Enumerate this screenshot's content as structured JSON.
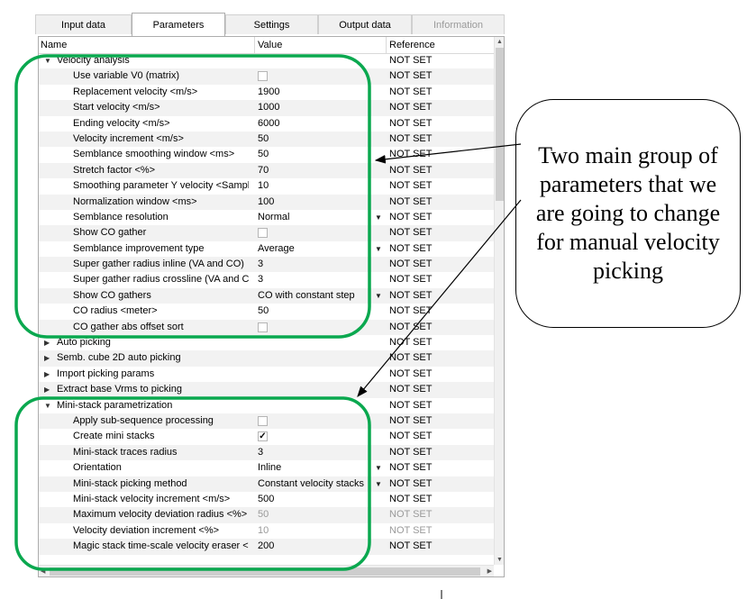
{
  "tabs": [
    {
      "label": "Input data",
      "state": "normal"
    },
    {
      "label": "Parameters",
      "state": "active"
    },
    {
      "label": "Settings",
      "state": "normal"
    },
    {
      "label": "Output data",
      "state": "normal"
    },
    {
      "label": "Information",
      "state": "disabled"
    }
  ],
  "columns": {
    "name": "Name",
    "value": "Value",
    "reference": "Reference"
  },
  "rows": [
    {
      "name": "Velocity analysis",
      "value": "",
      "reference": "NOT SET",
      "group": true,
      "expanded": true
    },
    {
      "name": "Use variable V0 (matrix)",
      "value": "",
      "reference": "NOT SET",
      "checkbox": false
    },
    {
      "name": "Replacement velocity <m/s>",
      "value": "1900",
      "reference": "NOT SET"
    },
    {
      "name": "Start velocity <m/s>",
      "value": "1000",
      "reference": "NOT SET"
    },
    {
      "name": "Ending velocity <m/s>",
      "value": "6000",
      "reference": "NOT SET"
    },
    {
      "name": "Velocity increment <m/s>",
      "value": "50",
      "reference": "NOT SET"
    },
    {
      "name": "Semblance smoothing window <ms>",
      "value": "50",
      "reference": "NOT SET"
    },
    {
      "name": "Stretch factor <%>",
      "value": "70",
      "reference": "NOT SET"
    },
    {
      "name": "Smoothing parameter Y velocity <Sampl...",
      "value": "10",
      "reference": "NOT SET"
    },
    {
      "name": "Normalization window <ms>",
      "value": "100",
      "reference": "NOT SET"
    },
    {
      "name": "Semblance resolution",
      "value": "Normal",
      "reference": "NOT SET",
      "dropdown": true
    },
    {
      "name": "Show CO gather",
      "value": "",
      "reference": "NOT SET",
      "checkbox": false
    },
    {
      "name": "Semblance improvement type",
      "value": "Average",
      "reference": "NOT SET",
      "dropdown": true
    },
    {
      "name": "Super gather radius inline (VA and CO)",
      "value": "3",
      "reference": "NOT SET"
    },
    {
      "name": "Super gather radius crossline (VA and CO)",
      "value": "3",
      "reference": "NOT SET"
    },
    {
      "name": "Show CO gathers",
      "value": "CO with constant step",
      "reference": "NOT SET",
      "dropdown": true
    },
    {
      "name": "CO radius <meter>",
      "value": "50",
      "reference": "NOT SET"
    },
    {
      "name": "CO gather abs offset sort",
      "value": "",
      "reference": "NOT SET",
      "checkbox": false
    },
    {
      "name": "Auto picking",
      "value": "",
      "reference": "NOT SET",
      "group": true,
      "expanded": false
    },
    {
      "name": "Semb. cube 2D auto picking",
      "value": "",
      "reference": "NOT SET",
      "group": true,
      "expanded": false
    },
    {
      "name": "Import picking params",
      "value": "",
      "reference": "NOT SET",
      "group": true,
      "expanded": false
    },
    {
      "name": "Extract base Vrms to picking",
      "value": "",
      "reference": "NOT SET",
      "group": true,
      "expanded": false
    },
    {
      "name": "Mini-stack parametrization",
      "value": "",
      "reference": "NOT SET",
      "group": true,
      "expanded": true
    },
    {
      "name": "Apply sub-sequence processing",
      "value": "",
      "reference": "NOT SET",
      "checkbox": false
    },
    {
      "name": "Create mini stacks",
      "value": "",
      "reference": "NOT SET",
      "checkbox": true
    },
    {
      "name": "Mini-stack traces radius",
      "value": "3",
      "reference": "NOT SET"
    },
    {
      "name": "Orientation",
      "value": "Inline",
      "reference": "NOT SET",
      "dropdown": true
    },
    {
      "name": "Mini-stack picking method",
      "value": "Constant velocity stacks",
      "reference": "NOT SET",
      "dropdown": true
    },
    {
      "name": "Mini-stack velocity increment <m/s>",
      "value": "500",
      "reference": "NOT SET"
    },
    {
      "name": "Maximum velocity deviation radius <%>",
      "value": "50",
      "reference": "NOT SET",
      "disabled": true
    },
    {
      "name": "Velocity deviation increment <%>",
      "value": "10",
      "reference": "NOT SET",
      "disabled": true
    },
    {
      "name": "Magic stack time-scale velocity eraser <...",
      "value": "200",
      "reference": "NOT SET"
    }
  ],
  "callout": {
    "text": "Two main group of parameters that we are going to change for manual velocity picking"
  },
  "colors": {
    "highlight": "#0aa84f",
    "grid_alt_row": "#f2f2f2",
    "tab_bg": "#f0f0f0"
  }
}
